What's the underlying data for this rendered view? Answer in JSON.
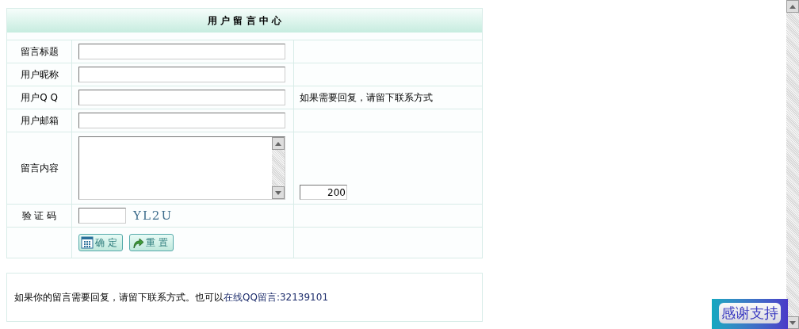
{
  "form": {
    "title": "用 户 留 言 中 心",
    "rows": [
      {
        "kind": "text",
        "label": "留言标题"
      },
      {
        "kind": "text",
        "label": "用户昵称"
      },
      {
        "kind": "text",
        "label": "用户Q Q",
        "hint": "如果需要回复，请留下联系方式"
      },
      {
        "kind": "text",
        "label": "用户邮箱"
      },
      {
        "kind": "textarea",
        "label": "留言内容",
        "counter": "200"
      },
      {
        "kind": "captcha",
        "label": "验 证 码",
        "captcha": "YL2U"
      },
      {
        "kind": "buttons",
        "buttons": [
          {
            "label": "确 定",
            "kind": "submit"
          },
          {
            "label": "重 置",
            "kind": "reset"
          }
        ]
      }
    ]
  },
  "note": {
    "text": "如果你的留言需要回复，请留下联系方式。也可以",
    "link": "在线QQ留言:32139101"
  },
  "badge": "感谢支持"
}
